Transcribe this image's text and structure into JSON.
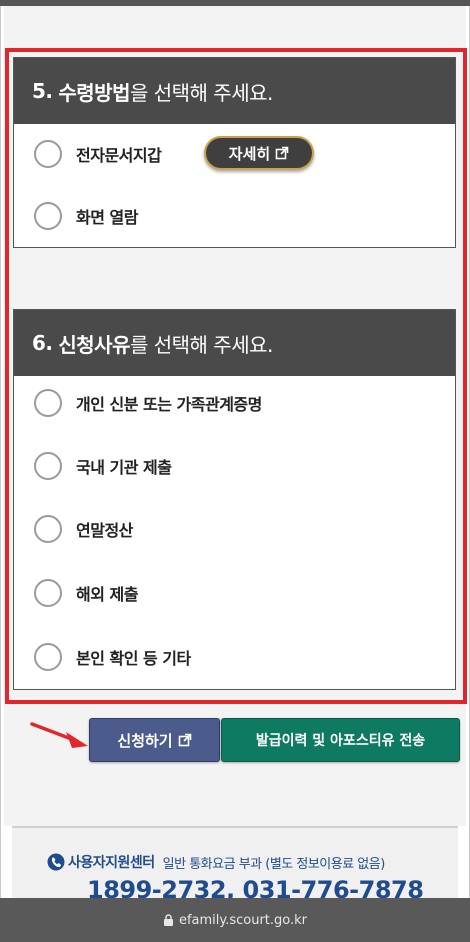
{
  "section5": {
    "num": "5.",
    "bold": "수령방법",
    "rest": "을 선택해 주세요.",
    "options": [
      {
        "label": "전자문서지갑"
      },
      {
        "label": "화면 열람"
      }
    ],
    "detail_label": "자세히"
  },
  "section6": {
    "num": "6.",
    "bold": "신청사유",
    "rest": "를 선택해 주세요.",
    "options": [
      {
        "label": "개인 신분 또는 가족관계증명"
      },
      {
        "label": "국내 기관 제출"
      },
      {
        "label": "연말정산"
      },
      {
        "label": "해외 제출"
      },
      {
        "label": "본인 확인 등 기타"
      }
    ]
  },
  "actions": {
    "apply_label": "신청하기",
    "history_label": "발급이력 및 아포스티유 전송"
  },
  "support": {
    "title": "사용자지원센터",
    "note": "일반 통화요금 부과 (별도 정보이용료 없음)",
    "phones": "1899-2732, 031-776-7878"
  },
  "browser": {
    "url": "efamily.scourt.go.kr"
  },
  "colors": {
    "highlight": "#e3262b",
    "header": "#4a4a4a",
    "apply": "#4a5b8c",
    "history": "#0f7a62",
    "support_text": "#1f4b8f"
  }
}
